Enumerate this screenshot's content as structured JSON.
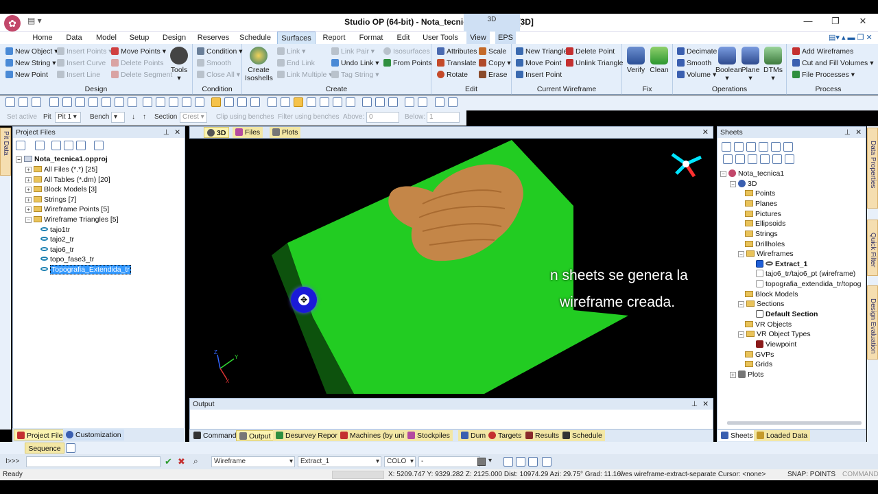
{
  "titlebar": {
    "title": "Studio OP (64-bit) - Nota_tecnica1.opproj * - [3D]",
    "context_tab": "3D"
  },
  "ribbon_tabs": [
    "Home",
    "Data",
    "Model",
    "Setup",
    "Design",
    "Reserves",
    "Schedule",
    "Surfaces",
    "Report",
    "Format",
    "Edit",
    "User Tools",
    "View",
    "EPS"
  ],
  "active_tab": "Surfaces",
  "ribbon": {
    "design": {
      "label": "Design",
      "items": [
        "New Object",
        "New String",
        "New Point",
        "Insert Points",
        "Insert Curve",
        "Insert Line",
        "Move Points",
        "Delete Points",
        "Delete Segment",
        "Tools"
      ]
    },
    "condition": {
      "label": "Condition",
      "items": [
        "Condition",
        "Smooth",
        "Close All"
      ]
    },
    "create": {
      "label": "Create",
      "items": [
        "Create Isoshells",
        "Link",
        "End Link",
        "Link Multiple",
        "Link Pair",
        "Undo Link",
        "Tag String",
        "Isosurfaces",
        "From Points"
      ]
    },
    "edit": {
      "label": "Edit",
      "items": [
        "Attributes",
        "Translate",
        "Rotate",
        "Scale",
        "Copy",
        "Erase"
      ]
    },
    "current_wireframe": {
      "label": "Current Wireframe",
      "items": [
        "New Triangle",
        "Move Point",
        "Insert Point",
        "Delete Point",
        "Unlink Triangle"
      ]
    },
    "fix": {
      "label": "Fix",
      "items": [
        "Verify",
        "Clean"
      ]
    },
    "operations": {
      "label": "Operations",
      "items": [
        "Decimate",
        "Smooth",
        "Volume",
        "Boolean",
        "Plane",
        "DTMs"
      ]
    },
    "process": {
      "label": "Process",
      "items": [
        "Add Wireframes",
        "Cut and Fill Volumes",
        "File Processes"
      ]
    }
  },
  "toolbar2": {
    "set_active": "Set active",
    "pit_label": "Pit",
    "pit_value": "Pit 1",
    "bench_label": "Bench",
    "section_label": "Section",
    "section_value": "Crest",
    "clip": "Clip using benches",
    "filter": "Filter using benches",
    "above_label": "Above:",
    "above_value": "0",
    "below_label": "Below:",
    "below_value": "1"
  },
  "project_files": {
    "title": "Project Files",
    "root": "Nota_tecnica1.opproj",
    "items": [
      "All Files (*.*) [25]",
      "All Tables (*.dm) [20]",
      "Block Models [3]",
      "Strings [7]",
      "Wireframe Points [5]",
      "Wireframe Triangles [5]"
    ],
    "children": [
      "tajo1tr",
      "tajo2_tr",
      "tajo6_tr",
      "topo_fase3_tr",
      "Topografia_Extendida_tr"
    ],
    "tabs": [
      "Project Files",
      "Customization"
    ],
    "side_tab": "Pit Data"
  },
  "view3d": {
    "tabs": [
      "3D",
      "Files",
      "Plots"
    ],
    "subtitle_line1": "n sheets se genera la",
    "subtitle_line2": "wireframe creada.",
    "axis": {
      "y": "Y",
      "z": "Z",
      "x": "X"
    }
  },
  "output": {
    "title": "Output",
    "tabs": [
      "Command",
      "Output",
      "Desurvey Report",
      "Machines (by unit)",
      "Stockpiles",
      "Dumps",
      "Targets",
      "Results",
      "Schedule"
    ]
  },
  "sheets": {
    "title": "Sheets",
    "root": "Nota_tecnica1",
    "nodes": [
      "3D",
      "Points",
      "Planes",
      "Pictures",
      "Ellipsoids",
      "Strings",
      "Drillholes",
      "Wireframes",
      "Extract_1",
      "tajo6_tr/tajo6_pt (wireframe)",
      "topografia_extendida_tr/topog",
      "Block Models",
      "Sections",
      "Default Section",
      "VR Objects",
      "VR Object Types",
      "Viewpoint",
      "GVPs",
      "Grids",
      "Plots"
    ],
    "tabs": [
      "Sheets",
      "Loaded Data"
    ],
    "side_tabs": [
      "Data Properties",
      "Quick Filter",
      "Design Evaluation"
    ]
  },
  "sequence": {
    "label": "Sequence"
  },
  "command_bar": {
    "prompt": "I>>>",
    "object_type": "Wireframe",
    "object_name": "Extract_1",
    "colour": "COLO",
    "dash": "-"
  },
  "status": {
    "ready": "Ready",
    "coords": "X: 5209.747 Y: 9329.282 Z: 2125.000 Dist: 10974.29 Azi: 29.75° Grad: 11.16°",
    "command": "wes wireframe-extract-separate Cursor: <none>",
    "snap": "SNAP: POINTS",
    "mode": "COMMAND"
  },
  "colors": {
    "ribbon_bg": "#e4eefa",
    "terrain": "#22cc22",
    "pit": "#c48648",
    "selection": "#3399ff"
  }
}
